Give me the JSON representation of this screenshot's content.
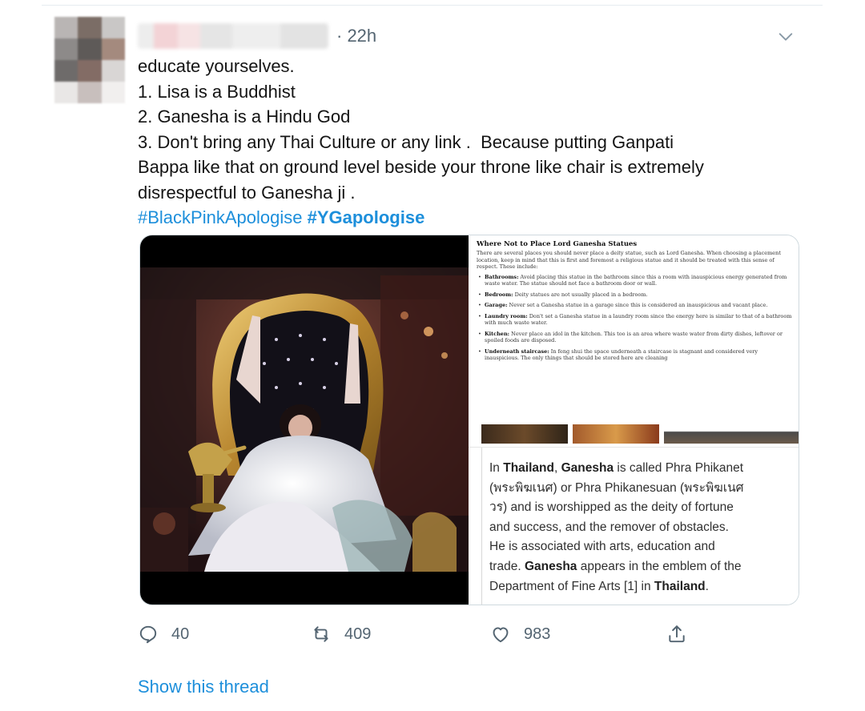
{
  "tweet": {
    "time": "· 22h",
    "body_lines": [
      "educate yourselves.",
      "1. Lisa is a Buddhist",
      "2. Ganesha is a Hindu God",
      "3. Don't bring any Thai Culture or any link .  Because putting Ganpati",
      "Bappa like that on ground level beside your throne like chair is extremely",
      "disrespectful to Ganesha ji ."
    ],
    "hashtags": [
      "#BlackPinkApologise",
      "#YGapologise"
    ]
  },
  "media": {
    "doc": {
      "title": "Where Not to Place Lord Ganesha Statues",
      "intro": "There are several places you should never place a deity statue, such as Lord Ganesha. When choosing a placement location, keep in mind that this is first and foremost a religious statue and it should be treated with this sense of respect. These include:",
      "items": [
        {
          "term": "Bathrooms:",
          "text": " Avoid placing this statue in the bathroom since this a room with inauspicious energy generated from waste water. The statue should not face a bathroom door or wall."
        },
        {
          "term": "Bedroom:",
          "text": " Deity statues are not usually placed in a bedroom."
        },
        {
          "term": "Garage:",
          "text": " Never set a Ganesha statue in a garage since this is considered an inauspicious and vacant place."
        },
        {
          "term": "Laundry room:",
          "text": " Don't set a Ganesha statue in a laundry room since the energy here is similar to that of a bathroom with much waste water."
        },
        {
          "term": "Kitchen:",
          "text": " Never place an idol in the kitchen. This too is an area where waste water from dirty dishes, leftover or spoiled foods are disposed."
        },
        {
          "term": "Underneath staircase:",
          "text": " In feng shui the space underneath a staircase is stagnant and considered very inauspicious. The only things that should be stored here are cleaning"
        }
      ]
    },
    "wiki": {
      "l1_a": "In ",
      "l1_b": "Thailand",
      "l1_c": ", ",
      "l1_d": "Ganesha",
      "l1_e": " is called Phra Phikanet",
      "l2": "(พระพิฆเนศ) or Phra Phikanesuan (พระพิฆเนศ",
      "l3": "วร) and is worshipped as the deity of fortune",
      "l4": "and success, and the remover of obstacles.",
      "l5": "He is associated with arts, education and",
      "l6_a": "trade. ",
      "l6_b": "Ganesha",
      "l6_c": " appears in the emblem of the",
      "l7_a": "Department of Fine Arts [1] in ",
      "l7_b": "Thailand",
      "l7_c": "."
    }
  },
  "actions": {
    "reply_count": "40",
    "retweet_count": "409",
    "like_count": "983"
  },
  "show_thread": "Show this thread",
  "colors": {
    "link": "#1d8fdb",
    "muted": "#536471",
    "border": "#cfd9de"
  }
}
